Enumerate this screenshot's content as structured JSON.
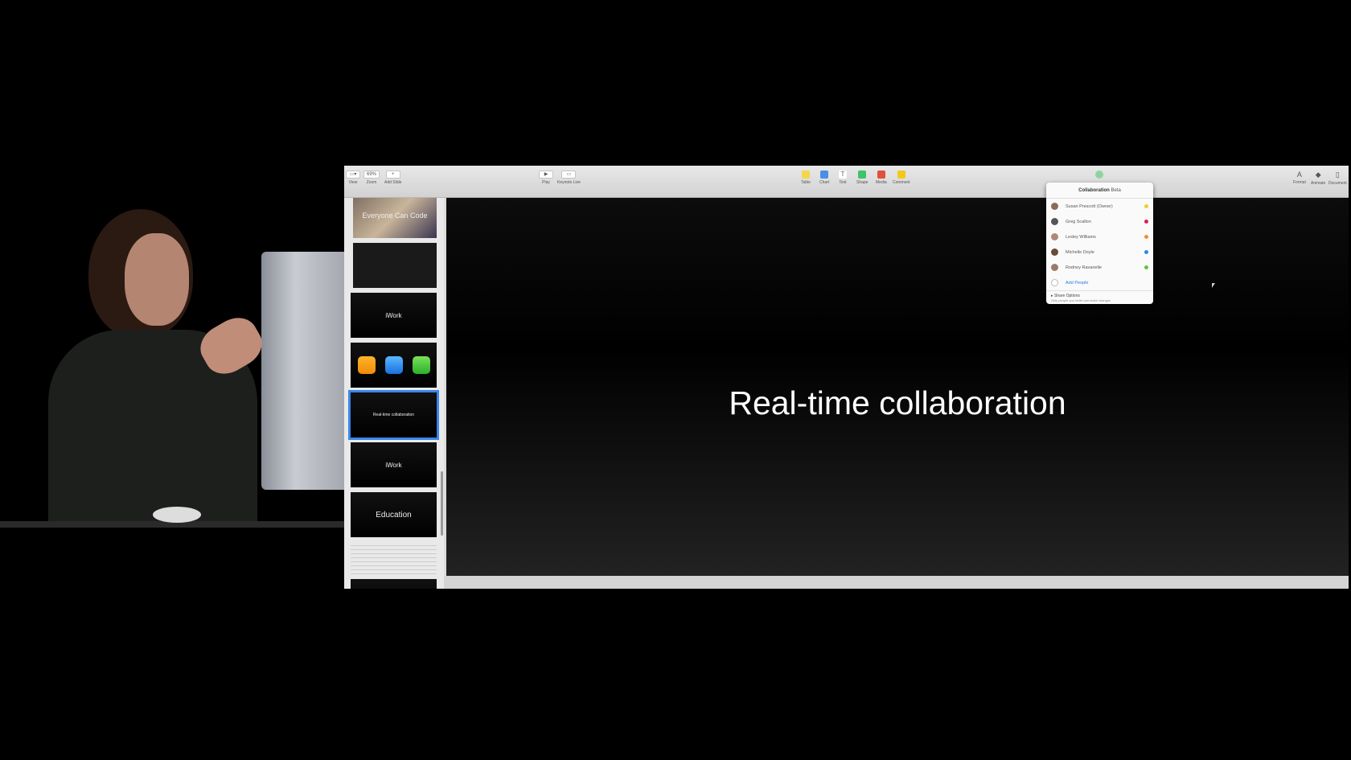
{
  "toolbar": {
    "left": [
      {
        "label": "View",
        "icon": "view-icon"
      },
      {
        "label": "Zoom",
        "value": "69%"
      },
      {
        "label": "Add Slide",
        "icon": "plus-icon"
      }
    ],
    "center_left": [
      {
        "label": "Play",
        "icon": "play-icon"
      },
      {
        "label": "Keynote Live",
        "icon": "keynote-live-icon"
      }
    ],
    "insert": [
      {
        "label": "Table",
        "color": "#f2d64b"
      },
      {
        "label": "Chart",
        "color": "#4a90e2"
      },
      {
        "label": "Text",
        "color": "#888888"
      },
      {
        "label": "Shape",
        "color": "#3cc46a"
      },
      {
        "label": "Media",
        "color": "#e0503c"
      },
      {
        "label": "Comment",
        "color": "#f2c81e"
      }
    ],
    "right": [
      {
        "label": "Format",
        "icon": "format-icon"
      },
      {
        "label": "Animate",
        "icon": "animate-icon"
      },
      {
        "label": "Document",
        "icon": "document-icon"
      }
    ]
  },
  "slides": [
    {
      "title": "Everyone Can Code"
    },
    {
      "title": ""
    },
    {
      "title": "iWork"
    },
    {
      "title": "",
      "icons": [
        "pages",
        "keynote",
        "numbers"
      ]
    },
    {
      "title": "Real-time collaboration",
      "selected": true
    },
    {
      "title": "iWork"
    },
    {
      "title": "Education"
    }
  ],
  "canvas": {
    "title": "Real-time collaboration"
  },
  "collaboration": {
    "title": "Collaboration",
    "badge": "Beta",
    "people": [
      {
        "name": "Susan Prescott (Owner)",
        "color": "#e8d22a"
      },
      {
        "name": "Greg Scallon",
        "color": "#e0204c"
      },
      {
        "name": "Lesley Williams",
        "color": "#f0902a"
      },
      {
        "name": "Michelle Doyle",
        "color": "#2a8ae8"
      },
      {
        "name": "Rodney Ravanelle",
        "color": "#5ac83a"
      }
    ],
    "add_people": "Add People",
    "share_options": "Share Options",
    "share_desc": "Only people you invite can make changes"
  }
}
